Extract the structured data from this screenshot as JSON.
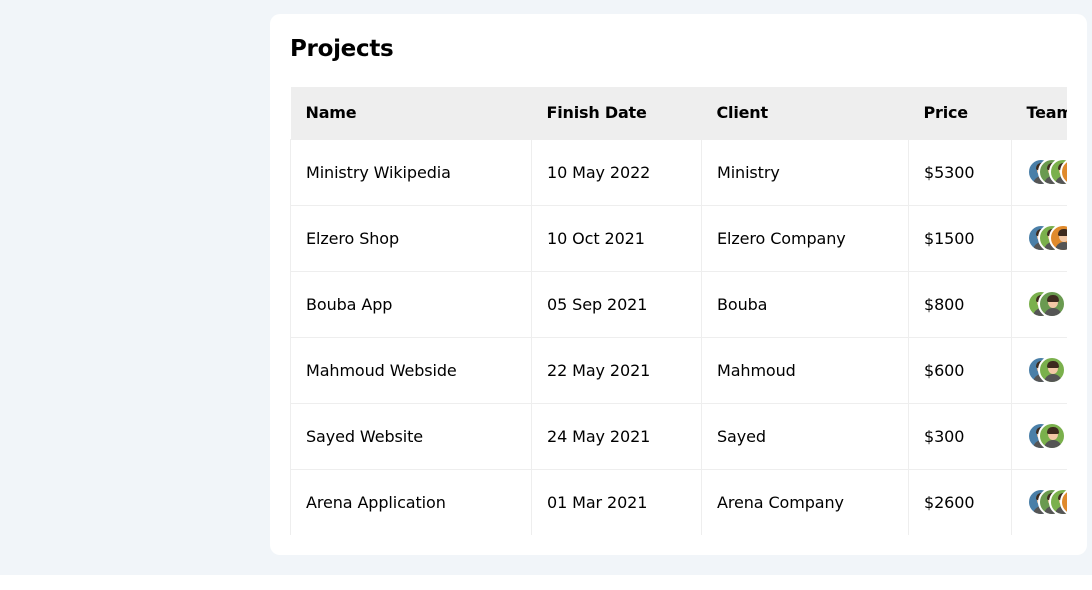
{
  "panel": {
    "title": "Projects"
  },
  "table": {
    "headers": [
      "Name",
      "Finish Date",
      "Client",
      "Price",
      "Team"
    ],
    "rows": [
      {
        "name": "Ministry Wikipedia",
        "date": "10 May 2022",
        "client": "Ministry",
        "price": "$5300",
        "team": [
          "#4a7fa8",
          "#6a9a50",
          "#7ab04c",
          "#e08a2c"
        ]
      },
      {
        "name": "Elzero Shop",
        "date": "10 Oct 2021",
        "client": "Elzero Company",
        "price": "$1500",
        "team": [
          "#4a7fa8",
          "#7ab04c",
          "#e08a2c"
        ]
      },
      {
        "name": "Bouba App",
        "date": "05 Sep 2021",
        "client": "Bouba",
        "price": "$800",
        "team": [
          "#7ab04c",
          "#6a9a50"
        ]
      },
      {
        "name": "Mahmoud Webside",
        "date": "22 May 2021",
        "client": "Mahmoud",
        "price": "$600",
        "team": [
          "#4a7fa8",
          "#7ab04c"
        ]
      },
      {
        "name": "Sayed Website",
        "date": "24 May 2021",
        "client": "Sayed",
        "price": "$300",
        "team": [
          "#4a7fa8",
          "#7ab04c"
        ]
      },
      {
        "name": "Arena Application",
        "date": "01 Mar 2021",
        "client": "Arena Company",
        "price": "$2600",
        "team": [
          "#4a7fa8",
          "#6a9a50",
          "#7ab04c",
          "#e08a2c"
        ]
      }
    ]
  }
}
